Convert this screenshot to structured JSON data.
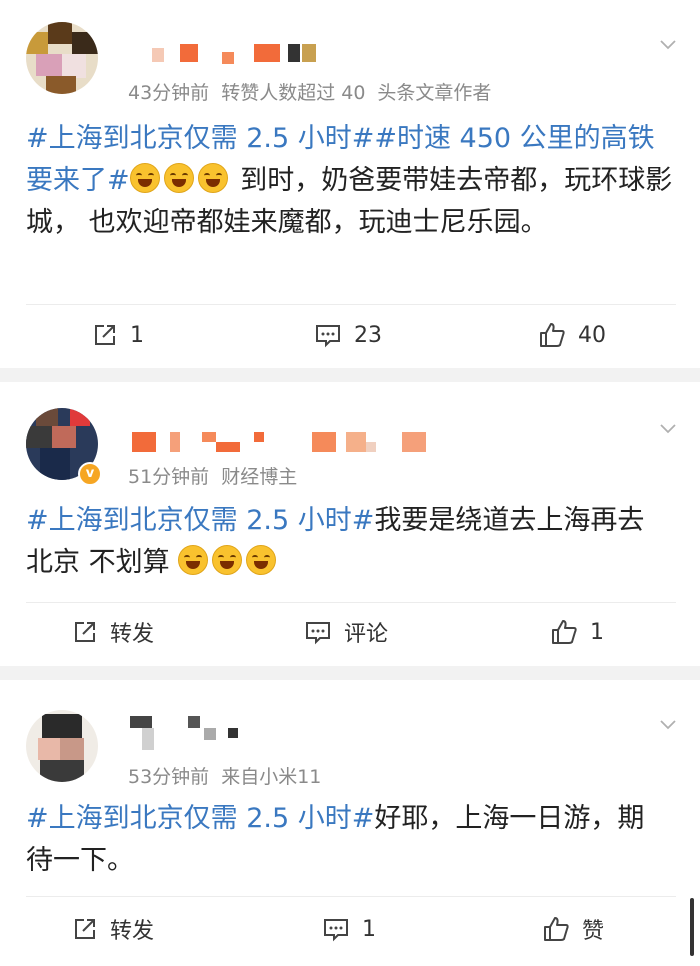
{
  "posts": [
    {
      "meta": {
        "time": "43分钟前",
        "note": "转赞人数超过 40",
        "source": "头条文章作者"
      },
      "text": {
        "tag": "#上海到北京仅需 2.5 小时##时速 450 公里的高铁要来了#",
        "body": " 到时，奶爸要带娃去帝都，玩环球影城， 也欢迎帝都娃来魔都，玩迪士尼乐园。"
      },
      "actions": {
        "repost": "1",
        "comment": "23",
        "like": "40"
      }
    },
    {
      "meta": {
        "time": "51分钟前",
        "note": "财经博主",
        "source": ""
      },
      "text": {
        "tag": "#上海到北京仅需 2.5 小时#",
        "body": "我要是绕道去上海再去北京 不划算 "
      },
      "verified_badge": "v",
      "actions": {
        "repost": "转发",
        "comment": "评论",
        "like": "1"
      }
    },
    {
      "meta": {
        "time": "53分钟前",
        "note": "来自小米11",
        "source": ""
      },
      "text": {
        "tag": "#上海到北京仅需 2.5 小时#",
        "body": "好耶，上海一日游，期待一下。"
      },
      "actions": {
        "repost": "转发",
        "comment": "1",
        "like": "赞"
      }
    }
  ],
  "icons": {
    "repost": "share-square-icon",
    "comment": "comment-bubble-icon",
    "like": "thumbs-up-icon",
    "more": "chevron-down-icon",
    "emoji": "laughing-emoji-icon"
  },
  "colors": {
    "tag": "#3a78c0",
    "meta": "#8a8a8a",
    "background": "#f2f2f2",
    "badge": "#f6a623"
  }
}
